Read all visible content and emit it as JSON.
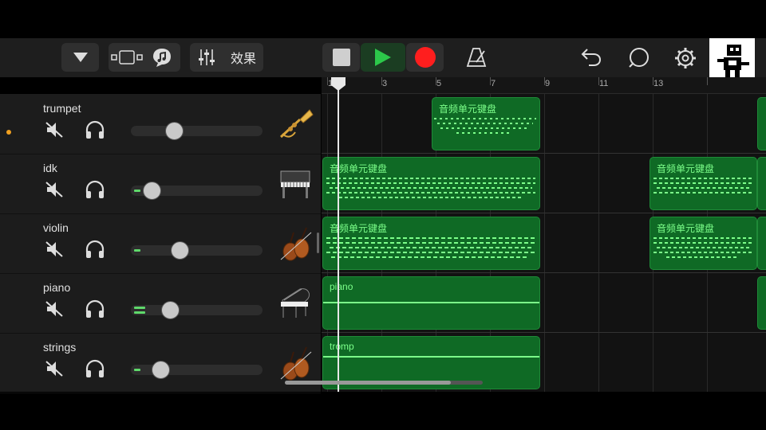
{
  "toolbar": {
    "effects_label": "效果",
    "icons": [
      "chevron-down-icon",
      "track-view-icon",
      "loop-browser-icon",
      "mixer-icon",
      "stop-icon",
      "play-icon",
      "record-icon",
      "metronome-icon",
      "undo-icon",
      "loop-icon",
      "settings-icon"
    ],
    "colors": {
      "play": "#2cc84a",
      "record": "#ff1e1e"
    }
  },
  "ruler": {
    "bars": [
      "1",
      "3",
      "5",
      "7",
      "9",
      "11",
      "13"
    ]
  },
  "tracks": [
    {
      "name": "trumpet",
      "instrument_icon": "trumpet-icon",
      "volume": 0.33,
      "level": 0
    },
    {
      "name": "idk",
      "instrument_icon": "piano-icon",
      "volume": 0.16,
      "level": 0.06
    },
    {
      "name": "violin",
      "instrument_icon": "violin-icon",
      "volume": 0.37,
      "level": 0.06
    },
    {
      "name": "piano",
      "instrument_icon": "grand-piano-icon",
      "volume": 0.3,
      "level": 0.09
    },
    {
      "name": "strings",
      "instrument_icon": "violin-icon",
      "volume": 0.23,
      "level": 0.06
    }
  ],
  "regions": {
    "trumpet_a": "音频单元键盘",
    "idk_a": "音频单元键盘",
    "idk_b": "音频单元键盘",
    "violin_a": "音频单元键盘",
    "violin_b": "音频单元键盘",
    "piano_a": "piano",
    "strings_a": "tromp"
  }
}
